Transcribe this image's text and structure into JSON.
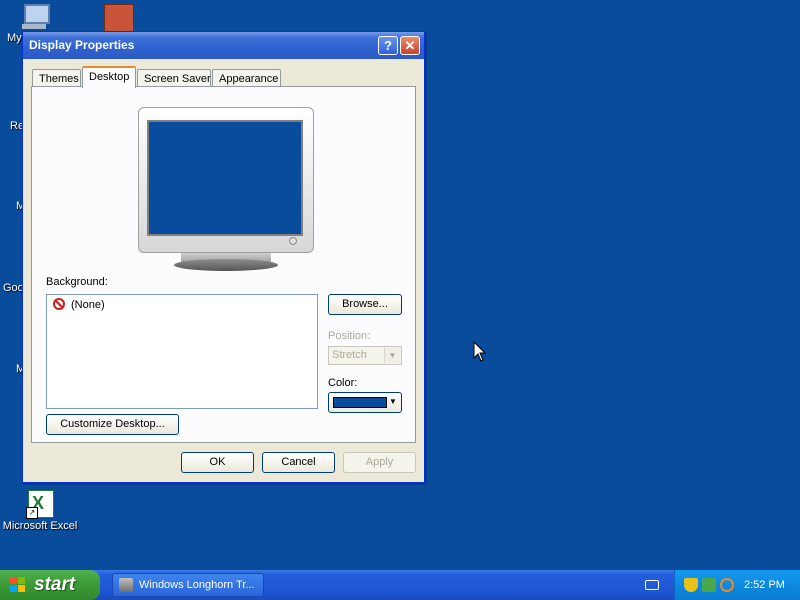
{
  "desktop": {
    "icons": [
      {
        "label": "My",
        "name": "my-computer-icon"
      },
      {
        "label": "Re",
        "name": "recycle-bin-icon"
      },
      {
        "label": "M",
        "name": "my-documents-icon"
      },
      {
        "label": "Goo",
        "name": "google-icon"
      },
      {
        "label": "M",
        "name": "media-icon"
      },
      {
        "label": "Microsoft Excel",
        "name": "excel-icon"
      }
    ]
  },
  "dialog": {
    "title": "Display Properties",
    "help_glyph": "?",
    "close_glyph": "✕",
    "tabs": [
      "Themes",
      "Desktop",
      "Screen Saver",
      "Appearance"
    ],
    "active_tab": "Desktop",
    "background_label": "Background:",
    "background_items": [
      "(None)"
    ],
    "browse_label": "Browse...",
    "position_label": "Position:",
    "position_value": "Stretch",
    "color_label": "Color:",
    "color_value": "#0a4c9c",
    "customize_label": "Customize Desktop...",
    "ok_label": "OK",
    "cancel_label": "Cancel",
    "apply_label": "Apply"
  },
  "taskbar": {
    "start_label": "start",
    "task_item": "Windows Longhorn Tr...",
    "clock": "2:52 PM"
  },
  "colors": {
    "desktop": "#0a4c9c",
    "title_bar": "#2f62cf",
    "taskbar": "#245edb",
    "start": "#3c9a37",
    "tray": "#0d8ae0"
  }
}
